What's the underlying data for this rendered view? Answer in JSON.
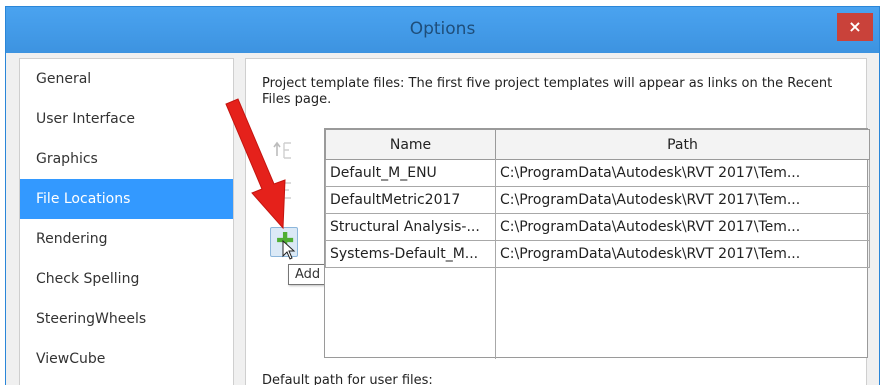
{
  "window": {
    "title": "Options",
    "close_label": "×"
  },
  "colors": {
    "titlebar": "#3d93e0",
    "selected_nav": "#3399ff",
    "close_button": "#c9423a",
    "arrow": "#e5211b",
    "add_icon": "#4fae33"
  },
  "nav": {
    "items": [
      {
        "label": "General"
      },
      {
        "label": "User Interface"
      },
      {
        "label": "Graphics"
      },
      {
        "label": "File Locations",
        "selected": true
      },
      {
        "label": "Rendering"
      },
      {
        "label": "Check Spelling"
      },
      {
        "label": "SteeringWheels"
      },
      {
        "label": "ViewCube"
      }
    ]
  },
  "content": {
    "intro_text": "Project template files:  The first five project templates will appear as links on the Recent Files page.",
    "buttons": {
      "move_up_icon": "move-up-icon",
      "move_down_icon": "move-down-icon",
      "add_icon": "plus-icon",
      "add_tooltip": "Add Value"
    },
    "table": {
      "headers": [
        "Name",
        "Path"
      ],
      "rows": [
        {
          "name": "Default_M_ENU",
          "path": "C:\\ProgramData\\Autodesk\\RVT 2017\\Tem..."
        },
        {
          "name": "DefaultMetric2017",
          "path": "C:\\ProgramData\\Autodesk\\RVT 2017\\Tem..."
        },
        {
          "name": "Structural Analysis-...",
          "path": "C:\\ProgramData\\Autodesk\\RVT 2017\\Tem..."
        },
        {
          "name": "Systems-Default_M...",
          "path": "C:\\ProgramData\\Autodesk\\RVT 2017\\Tem..."
        }
      ]
    },
    "default_path_label": "Default path for user files:"
  }
}
